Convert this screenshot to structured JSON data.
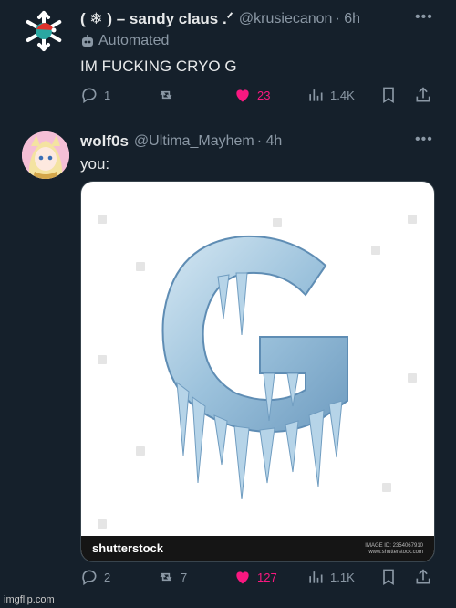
{
  "tweet1": {
    "display_name": "( ❄ ) – sandy claus .ᐟ",
    "handle": "@krusiecanon",
    "time": "· 6h",
    "automated_label": "Automated",
    "text": "IM FUCKING CRYO G",
    "replies": "1",
    "retweets": "",
    "likes": "23",
    "views": "1.4K"
  },
  "tweet2": {
    "display_name": "wolf0s",
    "handle": "@Ultima_Mayhem",
    "time": "· 4h",
    "text": "you:",
    "media": {
      "letter": "G",
      "watermark_logo": "shutterstock",
      "image_id": "IMAGE ID: 2354067910",
      "site": "www.shutterstock.com"
    },
    "replies": "2",
    "retweets": "7",
    "likes": "127",
    "views": "1.1K"
  },
  "footer": {
    "imgflip": "imgflip.com"
  },
  "colors": {
    "background": "#15202b",
    "like": "#f91880",
    "muted": "#8b98a5",
    "ice": "#9cc2dc"
  }
}
